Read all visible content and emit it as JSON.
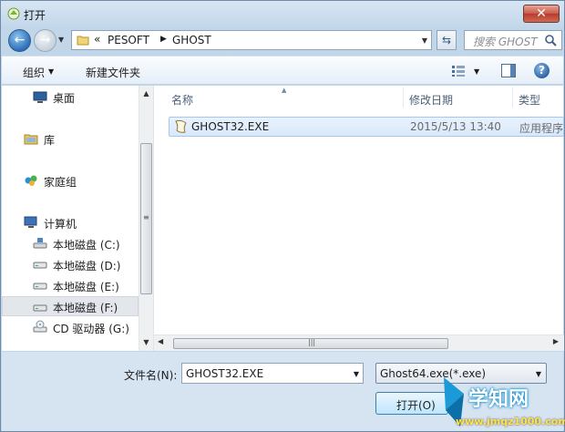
{
  "window": {
    "title": "打开",
    "close_glyph": "✕",
    "accent": "#c9584a"
  },
  "nav": {
    "back_glyph": "←",
    "forward_glyph": "→",
    "breadcrumb": {
      "overflow": "«",
      "items": [
        "PESOFT",
        "GHOST"
      ],
      "separator": "▶"
    },
    "refresh_glyph": "⇆",
    "search_placeholder": "搜索 GHOST"
  },
  "commandbar": {
    "organize": "组织",
    "new_folder": "新建文件夹",
    "dropdown_glyph": "▼"
  },
  "sidebar": {
    "items": [
      {
        "label": "桌面",
        "icon": "desktop-icon"
      },
      {
        "label": "库",
        "icon": "library-icon"
      },
      {
        "label": "家庭组",
        "icon": "homegroup-icon"
      },
      {
        "label": "计算机",
        "icon": "computer-icon"
      },
      {
        "label": "本地磁盘 (C:)",
        "icon": "system-drive-icon"
      },
      {
        "label": "本地磁盘 (D:)",
        "icon": "drive-icon"
      },
      {
        "label": "本地磁盘 (E:)",
        "icon": "drive-icon"
      },
      {
        "label": "本地磁盘 (F:)",
        "icon": "drive-icon",
        "selected": true
      },
      {
        "label": "CD 驱动器 (G:)",
        "icon": "cd-drive-icon"
      }
    ],
    "scroll_up": "▲",
    "scroll_down": "▼",
    "grip": "≡"
  },
  "filelist": {
    "columns": [
      "名称",
      "修改日期",
      "类型"
    ],
    "sort_glyph": "▲",
    "rows": [
      {
        "name": "GHOST32.EXE",
        "date": "2015/5/13 13:40",
        "type": "应用程序"
      }
    ],
    "scroll_left": "◀",
    "scroll_right": "▶",
    "grip": "|||"
  },
  "footer": {
    "filename_label": "文件名(N):",
    "filename_value": "GHOST32.EXE",
    "filetype_value": "Ghost64.exe(*.exe)",
    "open_label": "打开(O)",
    "dropdown_glyph": "▼"
  },
  "watermark": {
    "text": "学知网",
    "url": "www.jmqz1000.com"
  }
}
